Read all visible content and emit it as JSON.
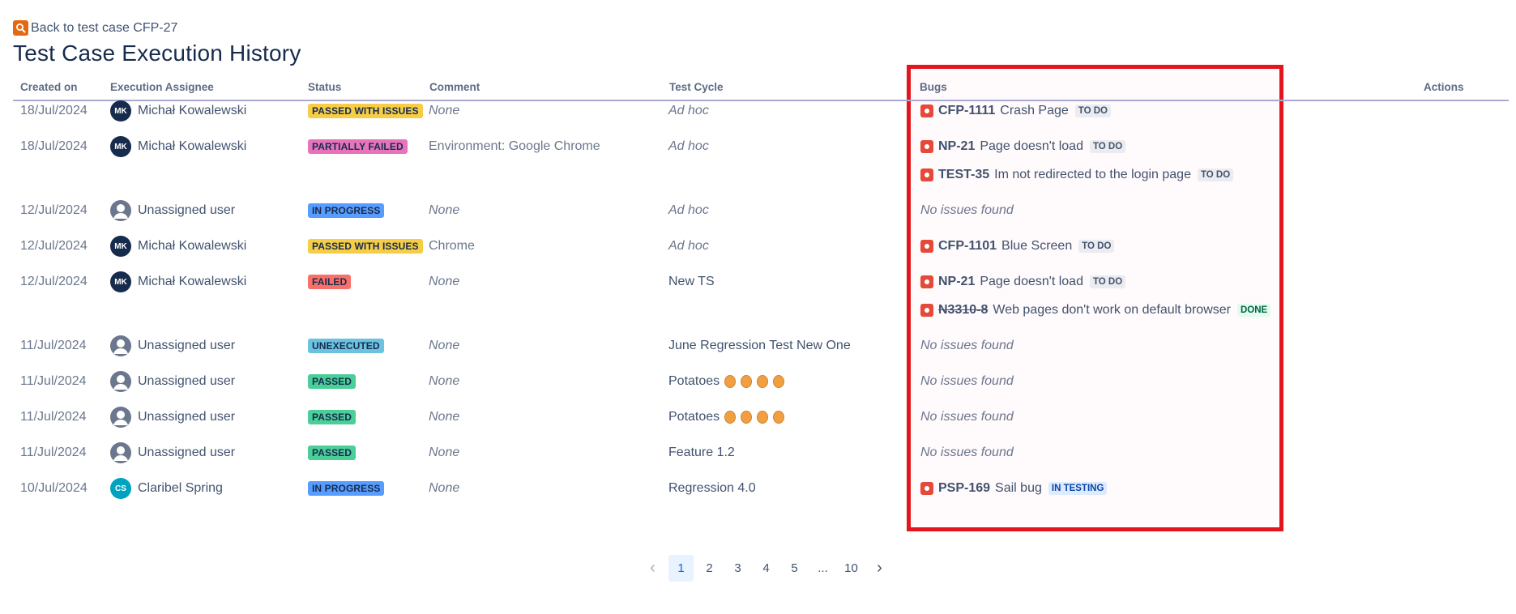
{
  "back_link": {
    "label": "Back to test case CFP-27",
    "icon": "search-icon"
  },
  "title": "Test Case Execution History",
  "columns": [
    "Created on",
    "Execution Assignee",
    "Status",
    "Comment",
    "Test Cycle",
    "Bugs",
    "Actions"
  ],
  "rows": [
    {
      "date": "18/Jul/2024",
      "assignee": "Michał Kowalewski",
      "initials": "MK",
      "status": "PASSED WITH ISSUES",
      "comment": "None",
      "cycle": "Ad hoc",
      "bugs": [
        {
          "key": "CFP-1111",
          "summary": "Crash Page",
          "state": "TO DO"
        }
      ]
    },
    {
      "date": "18/Jul/2024",
      "assignee": "Michał Kowalewski",
      "initials": "MK",
      "status": "PARTIALLY FAILED",
      "comment": "Environment: Google Chrome",
      "cycle": "Ad hoc",
      "bugs": [
        {
          "key": "NP-21",
          "summary": "Page doesn't load",
          "state": "TO DO"
        },
        {
          "key": "TEST-35",
          "summary": "Im not redirected to the login page",
          "state": "TO DO"
        }
      ]
    },
    {
      "date": "12/Jul/2024",
      "assignee": "Unassigned user",
      "initials": "",
      "status": "IN PROGRESS",
      "comment": "None",
      "cycle": "Ad hoc",
      "bugs_text": "No issues found"
    },
    {
      "date": "12/Jul/2024",
      "assignee": "Michał Kowalewski",
      "initials": "MK",
      "status": "PASSED WITH ISSUES",
      "comment": "Chrome",
      "cycle": "Ad hoc",
      "bugs": [
        {
          "key": "CFP-1101",
          "summary": "Blue Screen",
          "state": "TO DO"
        }
      ]
    },
    {
      "date": "12/Jul/2024",
      "assignee": "Michał Kowalewski",
      "initials": "MK",
      "status": "FAILED",
      "comment": "None",
      "cycle": "New TS",
      "bugs": [
        {
          "key": "NP-21",
          "summary": "Page doesn't load",
          "state": "TO DO"
        },
        {
          "key": "N3310-8",
          "summary": "Web pages don't work on default browser",
          "state": "DONE"
        }
      ]
    },
    {
      "date": "11/Jul/2024",
      "assignee": "Unassigned user",
      "initials": "",
      "status": "UNEXECUTED",
      "comment": "None",
      "cycle": "June Regression Test New One",
      "bugs_text": "No issues found"
    },
    {
      "date": "11/Jul/2024",
      "assignee": "Unassigned user",
      "initials": "",
      "status": "PASSED",
      "comment": "None",
      "cycle": "Potatoes",
      "bugs_text": "No issues found"
    },
    {
      "date": "11/Jul/2024",
      "assignee": "Unassigned user",
      "initials": "",
      "status": "PASSED",
      "comment": "None",
      "cycle": "Potatoes",
      "bugs_text": "No issues found"
    },
    {
      "date": "11/Jul/2024",
      "assignee": "Unassigned user",
      "initials": "",
      "status": "PASSED",
      "comment": "None",
      "cycle": "Feature 1.2",
      "bugs_text": "No issues found"
    },
    {
      "date": "10/Jul/2024",
      "assignee": "Claribel Spring",
      "initials": "CS",
      "status": "IN PROGRESS",
      "comment": "None",
      "cycle": "Regression 4.0",
      "bugs": [
        {
          "key": "PSP-169",
          "summary": "Sail bug",
          "state": "IN TESTING"
        }
      ]
    }
  ],
  "pagination": {
    "pages": [
      "1",
      "2",
      "3",
      "4",
      "5",
      "...",
      "10"
    ],
    "current": "1"
  },
  "colors": {
    "highlight": "#e3161e",
    "status": {
      "PASSED WITH ISSUES": "#f5cd47",
      "PARTIALLY FAILED": "#e774bb",
      "IN PROGRESS": "#579dff",
      "FAILED": "#f87168",
      "UNEXECUTED": "#6cc3e0",
      "PASSED": "#4bce97"
    },
    "lozenge": {
      "TO DO": {
        "bg": "#ebecf0",
        "fg": "#42526e"
      },
      "DONE": {
        "bg": "#e3fcef",
        "fg": "#006644"
      },
      "IN TESTING": {
        "bg": "#deebff",
        "fg": "#0747a6"
      }
    }
  }
}
